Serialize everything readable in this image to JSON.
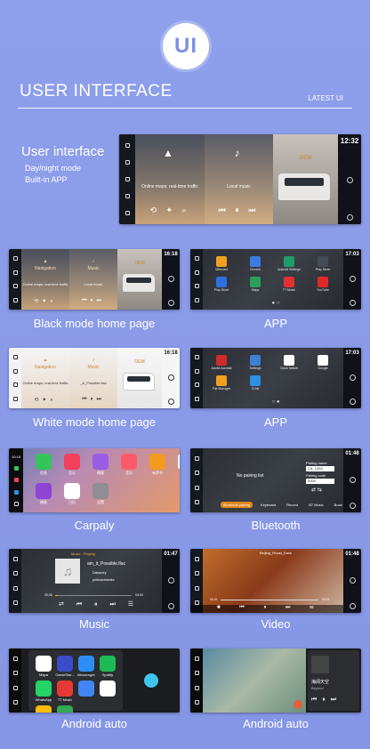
{
  "logo": {
    "text": "UI"
  },
  "header": {
    "title": "USER INTERFACE",
    "subtitle": "LATEST UI"
  },
  "intro": {
    "title": "User  interface",
    "lines": [
      "Day/night mode",
      "Built-in APP"
    ]
  },
  "home": {
    "time": "12:32",
    "nav_sub": "Online maps; real-time traffic",
    "music_sub": "Local music",
    "oem": "OEM"
  },
  "small_home_black": {
    "time": "16:18",
    "nav": "Navigation",
    "music": "Music",
    "oem": "OEM",
    "nav_sub": "Online maps; real-time traffic",
    "music_sub": "Local music"
  },
  "small_home_white": {
    "time": "16:18",
    "nav": "Navigation",
    "music": "Music",
    "oem": "OEM",
    "nav_sub": "Online maps; real-time traffic",
    "music_sub": "_A_Possible.flac"
  },
  "app1": {
    "time": "17:03",
    "apps": [
      {
        "label": "Wirecast",
        "color": "#f0a020"
      },
      {
        "label": "Chrome",
        "color": "#3a7de0"
      },
      {
        "label": "Android Settings",
        "color": "#1e9c6b"
      },
      {
        "label": "Play Store",
        "color": "#444b56"
      },
      {
        "label": "Play Store",
        "color": "#2f6fe0"
      },
      {
        "label": "Maps",
        "color": "#2aa05a"
      },
      {
        "label": "TT Music",
        "color": "#e03030"
      },
      {
        "label": "YouTube",
        "color": "#e02a2a"
      }
    ]
  },
  "app2": {
    "time": "17:03",
    "apps": [
      {
        "label": "Adobe Acrobat",
        "color": "#d22a2a"
      },
      {
        "label": "Settings",
        "color": "#3f7fd6"
      },
      {
        "label": "Clock Switch",
        "color": "#ffffff"
      },
      {
        "label": "Google",
        "color": "#ffffff"
      },
      {
        "label": "File Manager",
        "color": "#f0a020"
      },
      {
        "label": "ZLink",
        "color": "#2f8fe0"
      }
    ]
  },
  "carplay": {
    "time": "10:18",
    "apps": [
      {
        "label": "信息",
        "color": "#35c35b"
      },
      {
        "label": "音乐",
        "color": "#f2415a"
      },
      {
        "label": "播客",
        "color": "#9b5de5"
      },
      {
        "label": "音乐",
        "color": "#ff5a6a"
      },
      {
        "label": "有声书",
        "color": "#f39a1f"
      },
      {
        "label": "",
        "color": "#ffffff"
      },
      {
        "label": "播客",
        "color": "#8e44d6"
      },
      {
        "label": "日历",
        "color": "#ffffff"
      },
      {
        "label": "设置",
        "color": "#8e8e93"
      }
    ],
    "calendar_day": "3"
  },
  "bluetooth": {
    "time": "01:48",
    "status": "No pairing list",
    "pairing_name_label": "Pairing name",
    "pairing_name": "CA_1264",
    "pairing_code_label": "Pairing code",
    "pairing_code": "0000",
    "tabs": [
      "Bluetooth pairing",
      "Keyboard",
      "Record",
      "BT Music",
      "Book"
    ]
  },
  "music": {
    "time": "01:47",
    "header": "Music : Playing",
    "track": "am_it_Possible.flac",
    "artist": "Dakacey",
    "album": "pixkcadmedia",
    "elapsed": "00:06",
    "duration": "03:24"
  },
  "video": {
    "time": "01:48",
    "title": "Beijing_Roast_Duck",
    "elapsed": "00:01",
    "duration": "02:21"
  },
  "android1": {
    "apps": [
      {
        "label": "Mapa",
        "color": "#ffffff"
      },
      {
        "label": "GameStar...",
        "color": "#3a4cc8"
      },
      {
        "label": "Messenger",
        "color": "#2e8ef5"
      },
      {
        "label": "Spotify",
        "color": "#1db954"
      },
      {
        "label": "WhatsApp",
        "color": "#25d366"
      },
      {
        "label": "TT Music",
        "color": "#e53935"
      },
      {
        "label": "",
        "color": "#4285f4"
      },
      {
        "label": "",
        "color": "#ffffff"
      },
      {
        "label": "",
        "color": "#fbbc04"
      },
      {
        "label": "",
        "color": "#34a853"
      }
    ]
  },
  "android2": {
    "now_playing": "Beyond",
    "song": "海阔天空"
  },
  "captions": {
    "black_home": "Black mode home page",
    "app": "APP",
    "white_home": "White mode home page",
    "app2": "APP",
    "carplay": "Carpaly",
    "bluetooth": "Bluetooth",
    "music": "Music",
    "video": "Video",
    "android": "Android auto",
    "android2": "Android auto"
  }
}
